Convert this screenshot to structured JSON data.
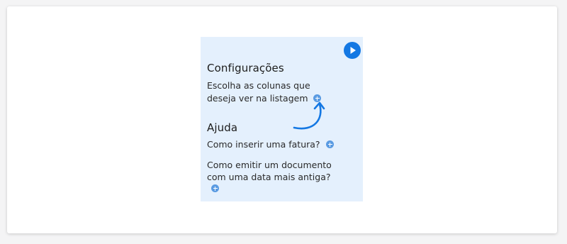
{
  "panel": {
    "background": "#e4f0fd",
    "play_icon": "play-icon",
    "accent": "#1478e3",
    "settings": {
      "title": "Configurações",
      "description_line1": "Escolha as colunas que",
      "description_line2": "deseja ver na listagem",
      "expand_icon": "plus-circle-icon"
    },
    "help": {
      "title": "Ajuda",
      "items": [
        {
          "label": "Como inserir uma fatura?",
          "icon": "plus-circle-icon"
        },
        {
          "label_line1": "Como emitir um documento",
          "label_line2": "com uma data mais antiga?",
          "icon": "plus-circle-icon"
        }
      ]
    },
    "hint_icon": "curved-arrow-icon"
  }
}
